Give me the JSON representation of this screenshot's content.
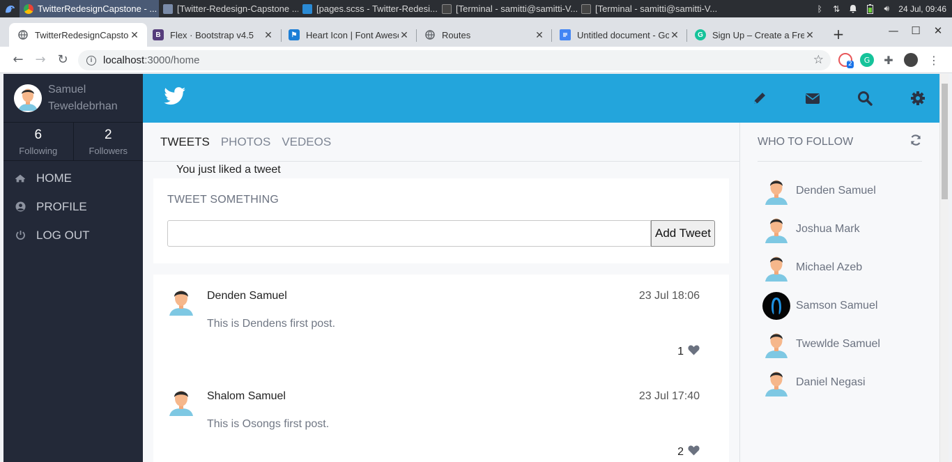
{
  "taskbar": {
    "tasks": [
      {
        "label": "TwitterRedesignCapstone - ...",
        "active": true,
        "color": "#4285f4"
      },
      {
        "label": "[Twitter-Redesign-Capstone ...",
        "active": false,
        "color": "#7a8ba8"
      },
      {
        "label": "[pages.scss - Twitter-Redesi...",
        "active": false,
        "color": "#2a8ad4"
      },
      {
        "label": "[Terminal - samitti@samitti-V...",
        "active": false,
        "color": "#444"
      },
      {
        "label": "[Terminal - samitti@samitti-V...",
        "active": false,
        "color": "#444"
      }
    ],
    "clock": "24 Jul, 09:46"
  },
  "browser": {
    "tabs": [
      {
        "label": "TwitterRedesignCapsto",
        "favicon": "globe-icon",
        "active": true
      },
      {
        "label": "Flex · Bootstrap v4.5",
        "favicon": "bootstrap-icon",
        "active": false
      },
      {
        "label": "Heart Icon | Font Aweso",
        "favicon": "flag-icon",
        "active": false
      },
      {
        "label": "Routes",
        "favicon": "globe-icon",
        "active": false
      },
      {
        "label": "Untitled document - Go",
        "favicon": "docs-icon",
        "active": false
      },
      {
        "label": "Sign Up – Create a Free",
        "favicon": "grammarly-icon",
        "active": false
      }
    ],
    "url_host": "localhost",
    "url_path": ":3000/home",
    "ext_badge": "2"
  },
  "sidebar": {
    "user_first": "Samuel",
    "user_last": "Teweldebrhan",
    "following_count": "6",
    "following_label": "Following",
    "followers_count": "2",
    "followers_label": "Followers",
    "menu": [
      {
        "label": "HOME",
        "icon": "home-icon"
      },
      {
        "label": "PROFILE",
        "icon": "user-circle-icon"
      },
      {
        "label": "LOG OUT",
        "icon": "power-icon"
      }
    ]
  },
  "main": {
    "tabs": [
      "TWEETS",
      "PHOTOS",
      "VEDEOS"
    ],
    "notice": "You just liked a tweet",
    "composer_title": "TWEET SOMETHING",
    "composer_placeholder": "",
    "add_button": "Add Tweet",
    "tweets": [
      {
        "author": "Denden Samuel",
        "date": "23 Jul 18:06",
        "body": "This is Dendens first post.",
        "likes": "1"
      },
      {
        "author": "Shalom Samuel",
        "date": "23 Jul 17:40",
        "body": "This is Osongs first post.",
        "likes": "2"
      }
    ]
  },
  "who_to_follow": {
    "title": "WHO TO FOLLOW",
    "users": [
      {
        "name": "Denden Samuel",
        "avatar": "default"
      },
      {
        "name": "Joshua Mark",
        "avatar": "default"
      },
      {
        "name": "Michael Azeb",
        "avatar": "default"
      },
      {
        "name": "Samson Samuel",
        "avatar": "custom"
      },
      {
        "name": "Twewlde Samuel",
        "avatar": "default"
      },
      {
        "name": "Daniel Negasi",
        "avatar": "default"
      }
    ]
  },
  "colors": {
    "topbar": "#23a5dc",
    "sidebar": "#232938"
  }
}
